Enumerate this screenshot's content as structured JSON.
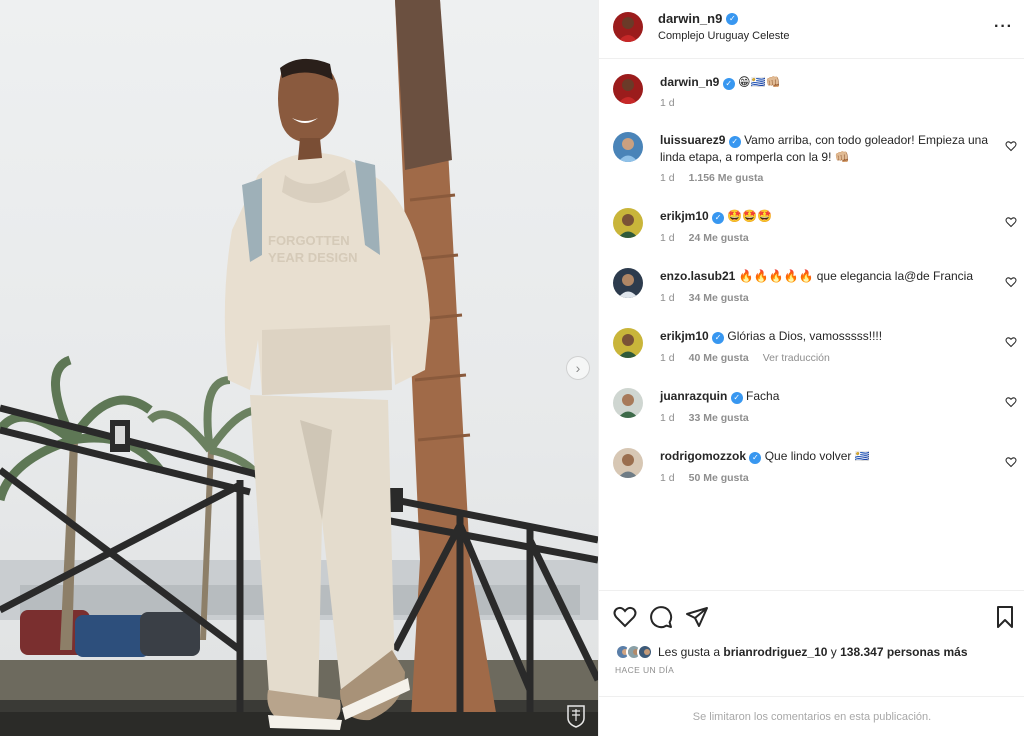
{
  "post": {
    "username": "darwin_n9",
    "location": "Complejo Uruguay Celeste",
    "caption": "😁🇺🇾👊🏼",
    "caption_time": "1 d",
    "time_ago": "HACE UN DÍA"
  },
  "comments": [
    {
      "user": "luissuarez9",
      "verified": true,
      "text": "Vamo arriba, con todo goleador! Empieza una linda etapa, a romperla con la 9! 👊🏼",
      "time": "1 d",
      "likes": "1.156 Me gusta",
      "extra": ""
    },
    {
      "user": "erikjm10",
      "verified": true,
      "text": "🤩🤩🤩",
      "time": "1 d",
      "likes": "24 Me gusta",
      "extra": ""
    },
    {
      "user": "enzo.lasub21",
      "verified": false,
      "text": "🔥🔥🔥🔥🔥 que elegancia la@de Francia",
      "time": "1 d",
      "likes": "34 Me gusta",
      "extra": ""
    },
    {
      "user": "erikjm10",
      "verified": true,
      "text": "Glórias a Dios, vamosssss!!!!",
      "time": "1 d",
      "likes": "40 Me gusta",
      "extra": "Ver traducción"
    },
    {
      "user": "juanrazquin",
      "verified": true,
      "text": "Facha",
      "time": "1 d",
      "likes": "33 Me gusta",
      "extra": ""
    },
    {
      "user": "rodrigomozzok",
      "verified": true,
      "text": "Que lindo volver 🇺🇾",
      "time": "1 d",
      "likes": "50 Me gusta",
      "extra": ""
    }
  ],
  "likes": {
    "prefix": "Les gusta a",
    "user": "brianrodriguez_10",
    "connector": "y",
    "count": "138.347 personas más"
  },
  "footer": "Se limitaron los comentarios en esta publicación.",
  "icons": {
    "more": "more-options-icon",
    "like": "heart-icon",
    "comment": "comment-icon",
    "share": "send-icon",
    "save": "bookmark-icon",
    "next": "chevron-right-icon"
  },
  "colors": {
    "verified": "#3897f0",
    "text": "#262626",
    "muted": "#8e8e8e"
  }
}
